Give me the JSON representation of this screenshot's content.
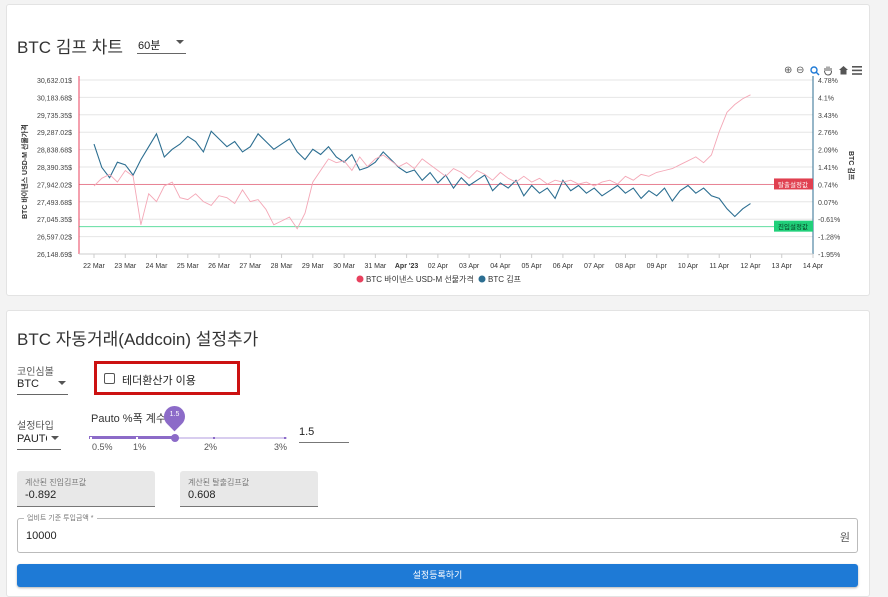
{
  "chart_card": {
    "title": "BTC 김프 차트",
    "interval_value": "60분"
  },
  "chart_data": {
    "type": "line",
    "x_ticks": [
      "22 Mar",
      "23 Mar",
      "24 Mar",
      "25 Mar",
      "26 Mar",
      "27 Mar",
      "28 Mar",
      "29 Mar",
      "30 Mar",
      "31 Mar",
      "Apr '23",
      "02 Apr",
      "03 Apr",
      "04 Apr",
      "05 Apr",
      "06 Apr",
      "07 Apr",
      "08 Apr",
      "09 Apr",
      "10 Apr",
      "11 Apr",
      "12 Apr",
      "13 Apr",
      "14 Apr"
    ],
    "y_left_label": "BTC 바이낸스 USD-M 선물가격",
    "y_left_ticks": [
      "30,632.01$",
      "30,183.68$",
      "29,735.35$",
      "29,287.02$",
      "28,838.68$",
      "28,390.35$",
      "27,942.02$",
      "27,493.68$",
      "27,045.35$",
      "26,597.02$",
      "26,148.69$"
    ],
    "y_left_range": [
      26148.69,
      30632.01
    ],
    "y_right_label": "BTC 김프",
    "y_right_ticks": [
      "4.78%",
      "4.1%",
      "3.43%",
      "2.76%",
      "2.09%",
      "1.41%",
      "0.74%",
      "0.07%",
      "-0.61%",
      "-1.28%",
      "-1.95%"
    ],
    "y_right_range": [
      -1.95,
      4.78
    ],
    "legend": [
      "BTC 바이낸스 USD-M 선물가격",
      "BTC 김프"
    ],
    "legend_colors": [
      "#e8415e",
      "#2c6e91"
    ],
    "exit_threshold_label": "탈출설정값",
    "exit_threshold_value": 0.74,
    "entry_threshold_label": "진입설정값",
    "entry_threshold_value": -0.892,
    "series": [
      {
        "name": "BTC 김프",
        "color": "#2c6e91",
        "x": [
          0,
          0.25,
          0.5,
          0.75,
          1,
          1.25,
          1.5,
          1.75,
          2,
          2.25,
          2.5,
          2.75,
          3,
          3.25,
          3.5,
          3.75,
          4,
          4.25,
          4.5,
          4.75,
          5,
          5.25,
          5.5,
          5.75,
          6,
          6.25,
          6.5,
          6.75,
          7,
          7.25,
          7.5,
          7.75,
          8,
          8.25,
          8.5,
          8.75,
          9,
          9.25,
          9.5,
          9.75,
          10,
          10.25,
          10.5,
          10.75,
          11,
          11.25,
          11.5,
          11.75,
          12,
          12.25,
          12.5,
          12.75,
          13,
          13.25,
          13.5,
          13.75,
          14,
          14.25,
          14.5,
          14.75,
          15,
          15.25,
          15.5,
          15.75,
          16,
          16.25,
          16.5,
          16.75,
          17,
          17.25,
          17.5,
          17.75,
          18,
          18.25,
          18.5,
          18.75,
          19,
          19.25,
          19.5,
          19.75,
          20,
          20.25,
          20.5,
          20.75,
          21
        ],
        "values": [
          2.3,
          1.4,
          1.0,
          1.6,
          1.5,
          1.1,
          1.7,
          2.2,
          2.7,
          1.8,
          2.1,
          2.3,
          2.6,
          2.4,
          2.0,
          2.8,
          2.5,
          2.2,
          2.4,
          2.0,
          2.2,
          2.7,
          2.4,
          2.1,
          2.3,
          2.5,
          2.0,
          1.7,
          2.1,
          1.9,
          2.2,
          1.8,
          1.6,
          1.9,
          1.3,
          1.4,
          1.6,
          2.0,
          1.7,
          1.4,
          1.2,
          1.3,
          0.9,
          1.2,
          0.8,
          1.1,
          0.6,
          1.0,
          0.7,
          0.9,
          1.1,
          0.5,
          0.8,
          0.6,
          0.9,
          0.3,
          0.7,
          0.4,
          0.6,
          0.2,
          0.9,
          0.5,
          0.7,
          0.4,
          0.6,
          0.3,
          0.5,
          0.7,
          0.4,
          0.6,
          0.2,
          0.5,
          0.3,
          0.6,
          0.1,
          0.5,
          0.7,
          0.4,
          0.6,
          0.3,
          0.2,
          -0.2,
          -0.5,
          -0.2,
          0.0
        ]
      },
      {
        "name": "BTC 바이낸스 USD-M 선물가격",
        "color": "#f4a7b6",
        "x": [
          0,
          0.25,
          0.5,
          0.75,
          1,
          1.25,
          1.5,
          1.75,
          2,
          2.25,
          2.5,
          2.75,
          3,
          3.25,
          3.5,
          3.75,
          4,
          4.25,
          4.5,
          4.75,
          5,
          5.25,
          5.5,
          5.75,
          6,
          6.25,
          6.5,
          6.75,
          7,
          7.25,
          7.5,
          7.75,
          8,
          8.25,
          8.5,
          8.75,
          9,
          9.25,
          9.5,
          9.75,
          10,
          10.25,
          10.5,
          10.75,
          11,
          11.25,
          11.5,
          11.75,
          12,
          12.25,
          12.5,
          12.75,
          13,
          13.25,
          13.5,
          13.75,
          14,
          14.25,
          14.5,
          14.75,
          15,
          15.25,
          15.5,
          15.75,
          16,
          16.25,
          16.5,
          16.75,
          17,
          17.25,
          17.5,
          17.75,
          18,
          18.25,
          18.5,
          18.75,
          19,
          19.25,
          19.5,
          19.75,
          20,
          20.25,
          20.5,
          20.75,
          21
        ],
        "values": [
          27900,
          28100,
          28200,
          28000,
          28300,
          28150,
          26900,
          27700,
          27500,
          27900,
          28000,
          27600,
          27550,
          27700,
          27500,
          27400,
          27650,
          27600,
          27450,
          27800,
          27500,
          27550,
          27300,
          26900,
          27000,
          27100,
          26800,
          27200,
          28000,
          28300,
          28600,
          28500,
          28550,
          28300,
          28650,
          28400,
          28600,
          28700,
          28550,
          28400,
          28500,
          28350,
          28600,
          28450,
          28300,
          28150,
          28350,
          28250,
          28100,
          28300,
          28200,
          28050,
          28250,
          28100,
          28000,
          28150,
          28000,
          28100,
          27950,
          28050,
          28000,
          28050,
          27950,
          28000,
          27900,
          28000,
          28050,
          27950,
          28150,
          28050,
          28200,
          28150,
          28250,
          28300,
          28350,
          28450,
          28550,
          28650,
          28500,
          28700,
          29300,
          29800,
          30000,
          30150,
          30250
        ]
      }
    ]
  },
  "settings_card": {
    "title": "BTC 자동거래(Addcoin) 설정추가",
    "coin_symbol_label": "코인심볼",
    "coin_symbol_value": "BTC",
    "tether_checkbox_label": "테더환산가 이용",
    "setting_type_label": "설정타입",
    "setting_type_value": "PAUTO",
    "slider_label": "Pauto %폭 계수",
    "slider_value_badge": "1.5",
    "slider_value": 1.5,
    "slider_marks": [
      "0.5%",
      "1%",
      "2%",
      "3%"
    ],
    "factor_input_value": "1.5",
    "calc_entry_label": "계산된 진입김프값",
    "calc_entry_value": "-0.892",
    "calc_exit_label": "계산된 탈출김프값",
    "calc_exit_value": "0.608",
    "buy_amount_label": "업비트 기준 투입금액 *",
    "buy_amount_value": "10000",
    "buy_amount_unit": "원",
    "submit_label": "설정등록하기"
  },
  "colors": {
    "accent": "#1e7ad6",
    "slider": "#8c6bc8",
    "highlight_box": "#cc1111",
    "exit_line": "#e8415e",
    "entry_line": "#21d07a",
    "premium_line": "#2c6e91"
  },
  "icons": [
    "zoom-in-icon",
    "zoom-out-icon",
    "magnifier-icon",
    "pan-hand-icon",
    "home-icon",
    "menu-icon"
  ]
}
